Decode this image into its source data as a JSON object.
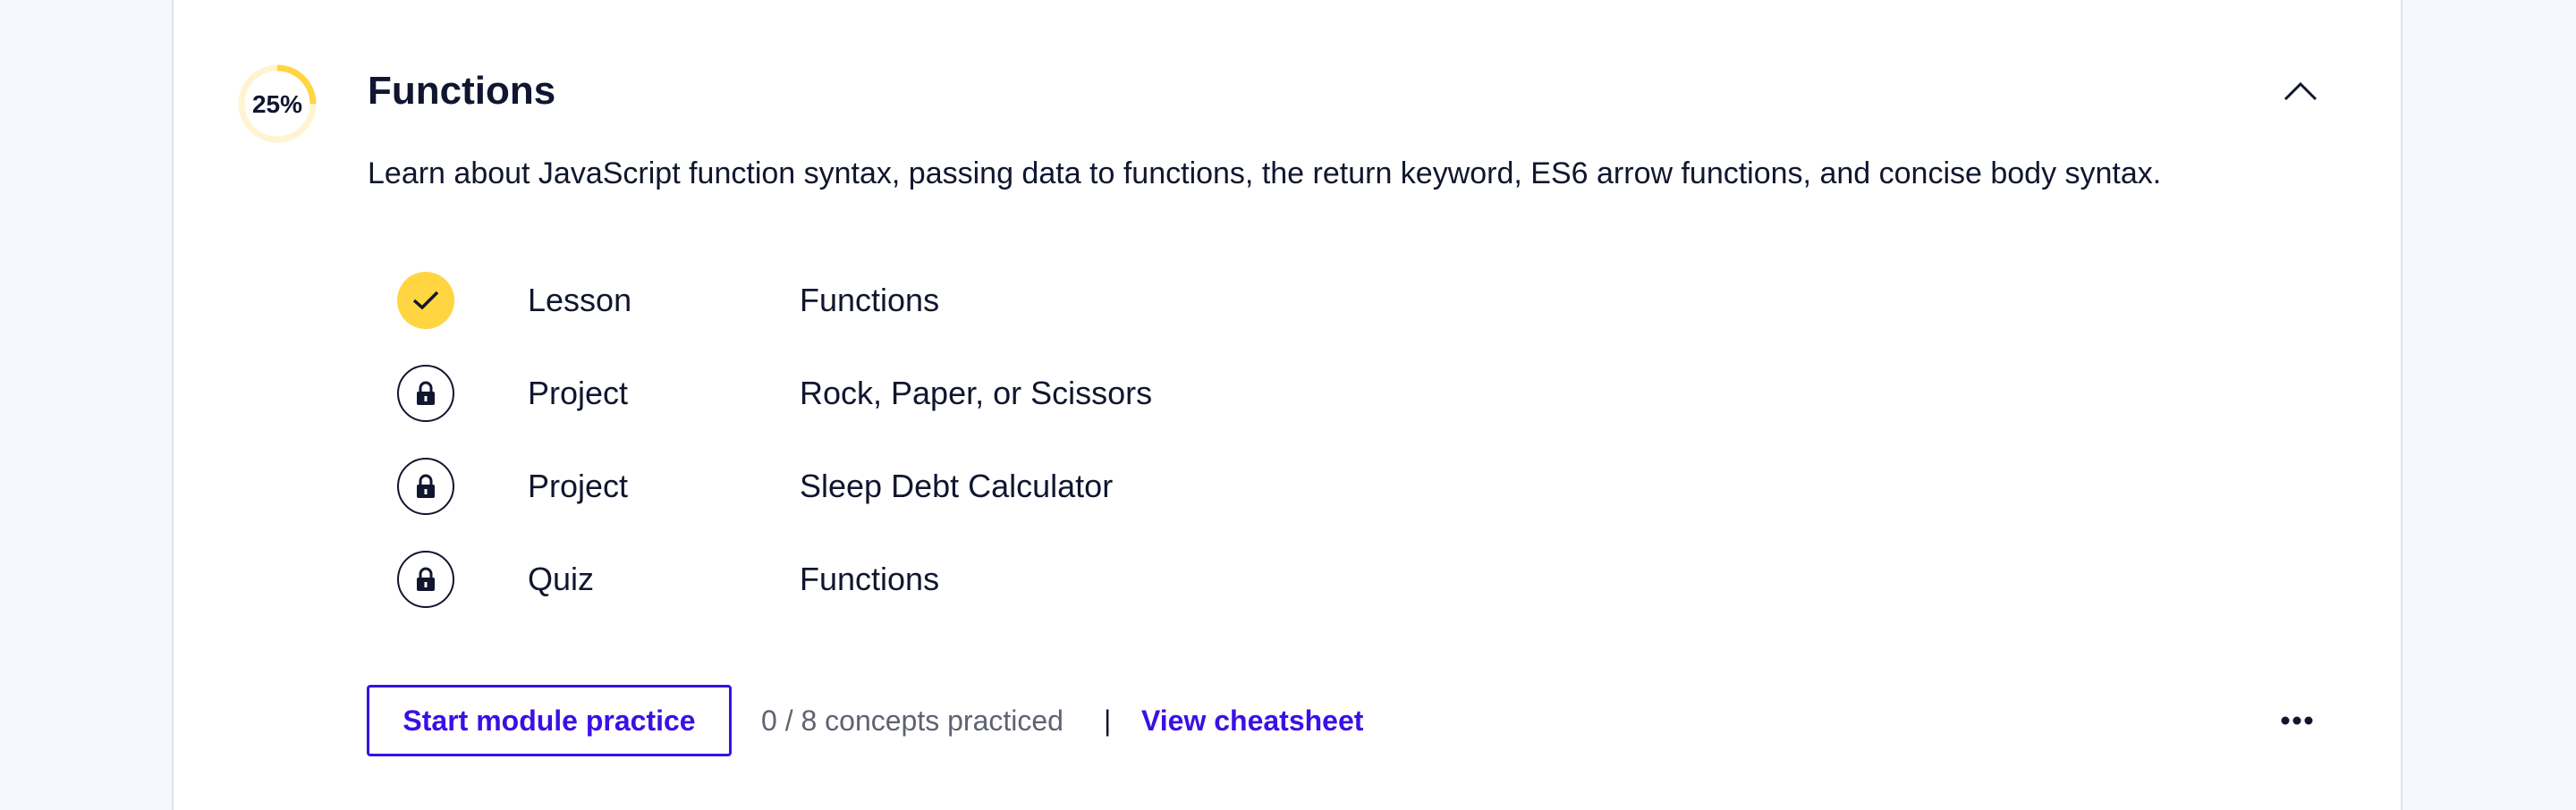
{
  "module": {
    "progress_label": "25%",
    "progress_fraction": 0.25,
    "title": "Functions",
    "description": "Learn about JavaScript function syntax, passing data to functions, the return keyword, ES6 arrow functions, and concise body syntax."
  },
  "items": [
    {
      "type": "Lesson",
      "name": "Functions",
      "status": "completed",
      "icon": "check-icon"
    },
    {
      "type": "Project",
      "name": "Rock, Paper, or Scissors",
      "status": "locked",
      "icon": "lock-icon"
    },
    {
      "type": "Project",
      "name": "Sleep Debt Calculator",
      "status": "locked",
      "icon": "lock-icon"
    },
    {
      "type": "Quiz",
      "name": "Functions",
      "status": "locked",
      "icon": "lock-icon"
    }
  ],
  "footer": {
    "practice_button_label": "Start module practice",
    "concepts_text": "0 / 8 concepts practiced",
    "divider": "|",
    "cheatsheet_label": "View cheatsheet",
    "more_icon": "ellipsis-icon"
  },
  "colors": {
    "accent": "#3a10e5",
    "completed": "#ffd542",
    "progress_track": "#fff4d1",
    "text": "#10162f",
    "muted": "#5f6270",
    "page_background": "#f5f8fc"
  }
}
